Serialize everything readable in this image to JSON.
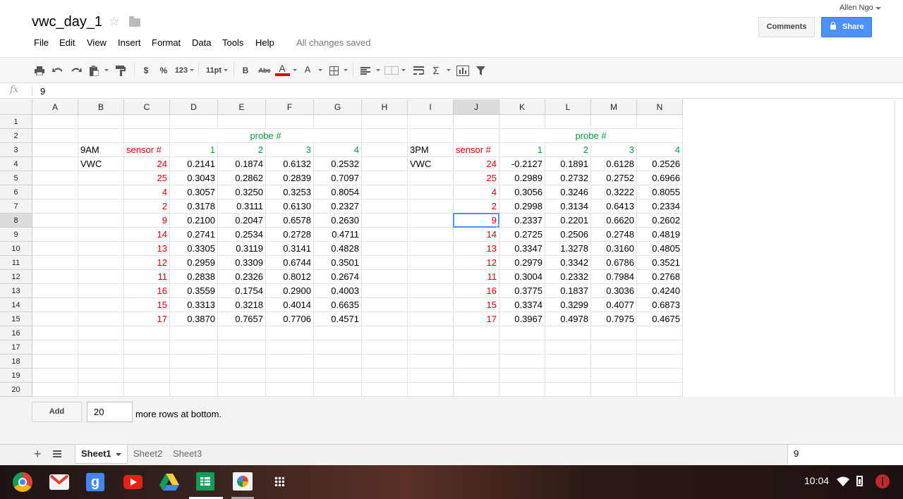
{
  "doc": {
    "title": "vwc_day_1",
    "user": "Allen Ngo",
    "comments_label": "Comments",
    "share_label": "Share",
    "save_status": "All changes saved"
  },
  "menu": [
    "File",
    "Edit",
    "View",
    "Insert",
    "Format",
    "Data",
    "Tools",
    "Help"
  ],
  "toolbar": {
    "currency": "$",
    "percent": "%",
    "number_format": "123",
    "font_size": "11pt",
    "bold": "B",
    "strikethrough": "Abc",
    "text_color": "A",
    "fill_color": "A",
    "sum": "Σ"
  },
  "formula_bar": {
    "fx": "fx",
    "value": "9"
  },
  "columns": [
    "A",
    "B",
    "C",
    "D",
    "E",
    "F",
    "G",
    "H",
    "I",
    "J",
    "K",
    "L",
    "M",
    "N"
  ],
  "rows": [
    "1",
    "2",
    "3",
    "4",
    "5",
    "6",
    "7",
    "8",
    "9",
    "10",
    "11",
    "12",
    "13",
    "14",
    "15",
    "16",
    "17",
    "18",
    "19",
    "20"
  ],
  "selected": {
    "column": "J",
    "row": "8"
  },
  "cells": {
    "D2": "probe #",
    "K2": "probe #",
    "B3": "9AM",
    "C3": "sensor #",
    "D3": "1",
    "E3": "2",
    "F3": "3",
    "G3": "4",
    "I3": "3PM",
    "J3": "sensor #",
    "K3": "1",
    "L3": "2",
    "M3": "3",
    "N3": "4",
    "B4": "VWC",
    "I4": "VWC"
  },
  "am_table": {
    "sensors": [
      "24",
      "25",
      "4",
      "2",
      "9",
      "14",
      "13",
      "12",
      "11",
      "16",
      "15",
      "17"
    ],
    "values": [
      [
        "0.2141",
        "0.1874",
        "0.6132",
        "0.2532"
      ],
      [
        "0.3043",
        "0.2862",
        "0.2839",
        "0.7097"
      ],
      [
        "0.3057",
        "0.3250",
        "0.3253",
        "0.8054"
      ],
      [
        "0.3178",
        "0.3111",
        "0.6130",
        "0.2327"
      ],
      [
        "0.2100",
        "0.2047",
        "0.6578",
        "0.2630"
      ],
      [
        "0.2741",
        "0.2534",
        "0.2728",
        "0.4711"
      ],
      [
        "0.3305",
        "0.3119",
        "0.3141",
        "0.4828"
      ],
      [
        "0.2959",
        "0.3309",
        "0.6744",
        "0.3501"
      ],
      [
        "0.2838",
        "0.2326",
        "0.8012",
        "0.2674"
      ],
      [
        "0.3559",
        "0.1754",
        "0.2900",
        "0.4003"
      ],
      [
        "0.3313",
        "0.3218",
        "0.4014",
        "0.6635"
      ],
      [
        "0.3870",
        "0.7657",
        "0.7706",
        "0.4571"
      ]
    ]
  },
  "pm_table": {
    "sensors": [
      "24",
      "25",
      "4",
      "2",
      "9",
      "14",
      "13",
      "12",
      "11",
      "16",
      "15",
      "17"
    ],
    "values": [
      [
        "-0.2127",
        "0.1891",
        "0.6128",
        "0.2526"
      ],
      [
        "0.2989",
        "0.2732",
        "0.2752",
        "0.6966"
      ],
      [
        "0.3056",
        "0.3246",
        "0.3222",
        "0.8055"
      ],
      [
        "0.2998",
        "0.3134",
        "0.6413",
        "0.2334"
      ],
      [
        "0.2337",
        "0.2201",
        "0.6620",
        "0.2602"
      ],
      [
        "0.2725",
        "0.2506",
        "0.2748",
        "0.4819"
      ],
      [
        "0.3347",
        "1.3278",
        "0.3160",
        "0.4805"
      ],
      [
        "0.2979",
        "0.3342",
        "0.6786",
        "0.3521"
      ],
      [
        "0.3004",
        "0.2332",
        "0.7984",
        "0.2768"
      ],
      [
        "0.3775",
        "0.1837",
        "0.3036",
        "0.4240"
      ],
      [
        "0.3374",
        "0.3299",
        "0.4077",
        "0.6873"
      ],
      [
        "0.3967",
        "0.4978",
        "0.7975",
        "0.4675"
      ]
    ]
  },
  "add_rows": {
    "button": "Add",
    "count": "20",
    "text": "more rows at bottom."
  },
  "sheets": [
    "Sheet1",
    "Sheet2",
    "Sheet3"
  ],
  "status_value": "9",
  "shelf": {
    "time": "10:04",
    "apps": [
      "chrome-icon",
      "gmail-icon",
      "google-search-icon",
      "youtube-icon",
      "drive-icon",
      "sheets-icon",
      "photos-icon",
      "apps-launcher-icon"
    ]
  },
  "colors": {
    "red": "#e00000",
    "green": "#00a040",
    "accent": "#4d90fe"
  }
}
